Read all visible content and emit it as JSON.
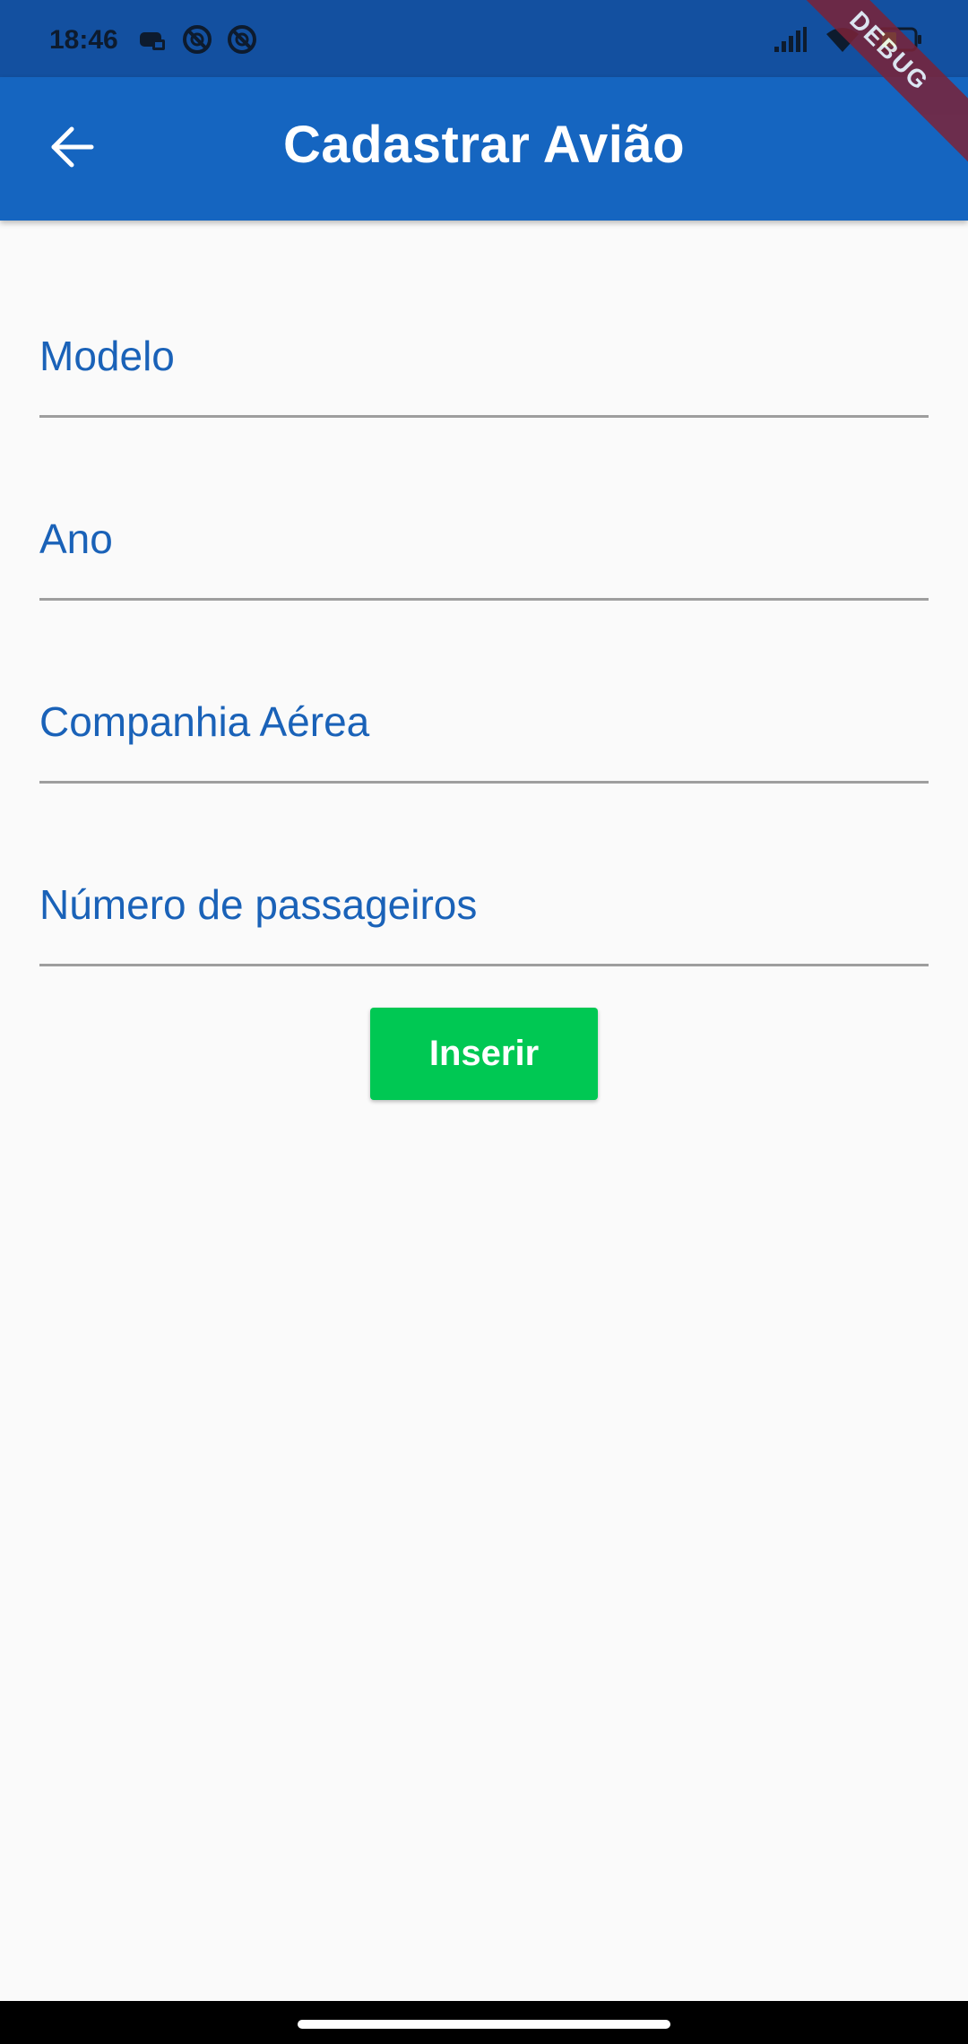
{
  "status_bar": {
    "time": "18:46",
    "left_icons": [
      "gamepad-icon",
      "no-disturb-icon",
      "no-disturb-icon"
    ],
    "right_icons": [
      "signal-icon",
      "wifi-icon",
      "battery-icon"
    ]
  },
  "app_bar": {
    "title": "Cadastrar Avião",
    "back_icon": "arrow-back-icon",
    "background_color": "#1565c0"
  },
  "debug_banner": "DEBUG",
  "form": {
    "fields": [
      {
        "label": "Modelo",
        "value": ""
      },
      {
        "label": "Ano",
        "value": ""
      },
      {
        "label": "Companhia Aérea",
        "value": ""
      },
      {
        "label": "Número de passageiros",
        "value": ""
      }
    ],
    "label_color": "#1a62b8",
    "submit_label": "Inserir",
    "submit_color": "#00c853"
  }
}
